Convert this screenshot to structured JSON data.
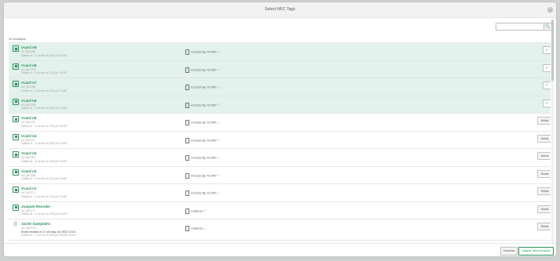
{
  "modal": {
    "title": "Select NFC Tags",
    "close_glyph": "×"
  },
  "search": {
    "value": "",
    "placeholder": "",
    "icon": "search-icon",
    "glyph": "🔍"
  },
  "results_count": "30 resultados",
  "rows": [
    {
      "name": "Vcard n9",
      "ref": "ref: Q8J-39B",
      "status": "Editado el · 11 de dic de 2023 por TicTAP",
      "template": "VCards By TicTAP",
      "selected": true
    },
    {
      "name": "Vcard n8",
      "ref": "ref: Q8J-32B",
      "status": "Editado el · 11 de dic de 2023 por TicTAP",
      "template": "VCards By TicTAP",
      "selected": true
    },
    {
      "name": "Vcard n7",
      "ref": "ref: Q8J-36B",
      "status": "Editado el · 11 de dic de 2023 por TicTAP",
      "template": "VCards By TicTAP",
      "selected": true
    },
    {
      "name": "Vcard n6",
      "ref": "ref: Q8J-35B",
      "status": "Editado el · 11 de dic de 2023 por TicTAP",
      "template": "VCards By TicTAP",
      "selected": true
    },
    {
      "name": "Vcard n5",
      "ref": "ref: Q8J-33F",
      "status": "Editado el · 11 de dic de 2023 por TicTAP",
      "template": "VCards By TicTAP",
      "selected": false
    },
    {
      "name": "Vcard n4",
      "ref": "ref: Q8J-34J",
      "status": "Editado el · 11 de dic de 2023 por TicTAP",
      "template": "VCards By TicTAP",
      "selected": false
    },
    {
      "name": "Vcard n3",
      "ref": "ref: Q8J-38J",
      "status": "Editado el · 11 de dic de 2023 por TicTAP",
      "template": "VCards By TicTAP",
      "selected": false
    },
    {
      "name": "Vcard n2",
      "ref": "ref: Q8J-36B",
      "status": "Editado el · 11 de dic de 2023 por TicTAP",
      "template": "VCards By TicTAP",
      "selected": false
    },
    {
      "name": "Vcard n1",
      "ref": "ref: Q8J-37J",
      "status": "Editado el · 11 de dic de 2023 por TicTAP",
      "template": "VCards By TicTAP",
      "selected": false
    },
    {
      "name": "Joaquín Recoder",
      "ref": "ref: Q8J-37J",
      "status": "Editado el · 11 de dic de 2023 por TicTAP",
      "template": "Calabria",
      "selected": false
    },
    {
      "name": "Javier Sampedro",
      "ref": "ref: Q8J-21H",
      "email": "Email enviado el 17 de may. de 2022 13:04",
      "status": "Editado el · 17 de dic de 2024 por Ricardo Torres",
      "template": "Calabria",
      "selected": false
    }
  ],
  "labels": {
    "select": "Select",
    "check_glyph": "✓",
    "warn_glyph": "⚠",
    "nfc_glyph": "))",
    "cancel": "Cancelar",
    "assign": "Asignar seleccionadas"
  },
  "colors": {
    "accent": "#1a8a4e",
    "selected_row": "#e3f2ec"
  }
}
